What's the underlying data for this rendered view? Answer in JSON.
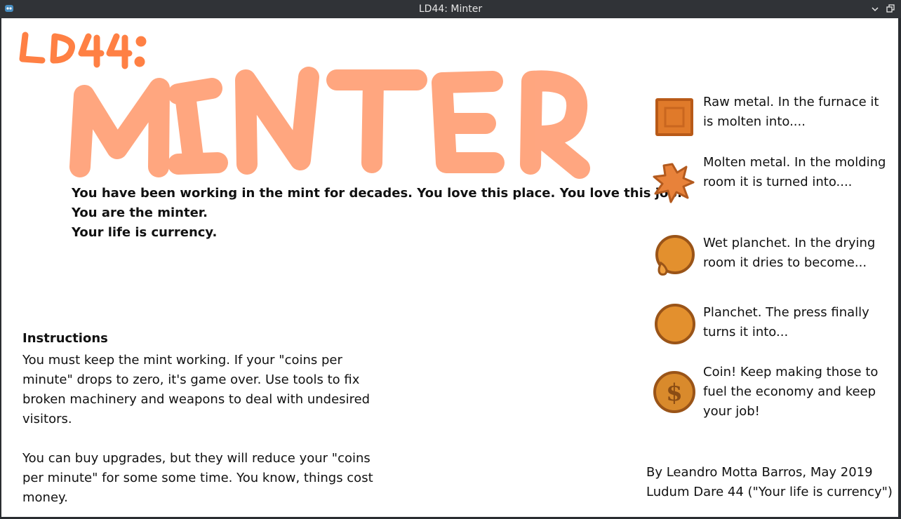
{
  "window": {
    "title": "LD44: Minter",
    "icons": {
      "app": "godot-icon",
      "minimize": "minimize-icon",
      "maximize": "restore-icon"
    }
  },
  "logo": {
    "small": "LD44:",
    "big": "MINTER",
    "color_small": "#ff7a3a",
    "color_big": "#ff9060"
  },
  "intro": {
    "lines": [
      "You have been working in the mint for decades. You love this place. You love this job.",
      "You are the minter.",
      "Your life is currency."
    ]
  },
  "instructions": {
    "heading": "Instructions",
    "paragraphs": [
      "You must keep the mint working. If your \"coins per minute\" drops to zero, it's game over. Use tools to fix broken machinery and weapons to deal with undesired visitors.",
      "You can buy upgrades, but they will reduce your \"coins per minute\" for some some time. You know, things cost money."
    ]
  },
  "legend": [
    {
      "icon": "raw-metal-icon",
      "text": "Raw metal. In the furnace it is molten into...."
    },
    {
      "icon": "molten-metal-icon",
      "text": "Molten metal. In the molding room it is turned into...."
    },
    {
      "icon": "wet-planchet-icon",
      "text": "Wet planchet. In the drying room it dries to become..."
    },
    {
      "icon": "planchet-icon",
      "text": "Planchet. The press finally turns it into..."
    },
    {
      "icon": "coin-icon",
      "text": "Coin! Keep making those to fuel the economy and keep your job!"
    }
  ],
  "credits": {
    "line1": "By Leandro Motta Barros, May 2019",
    "line2": "Ludum Dare 44 (\"Your life is currency\")"
  }
}
